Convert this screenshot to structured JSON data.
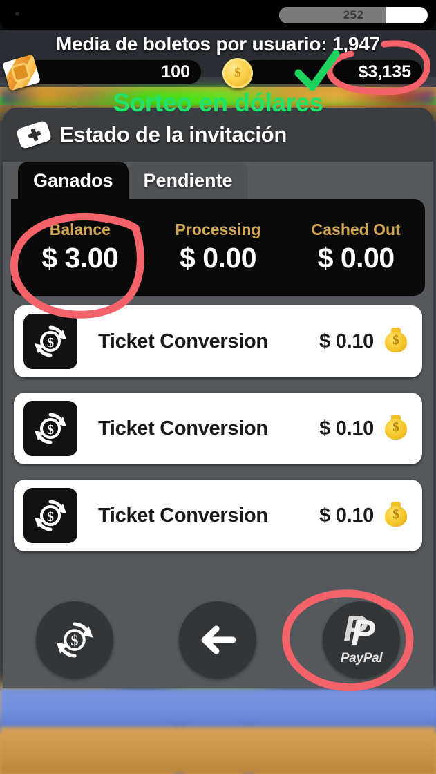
{
  "statusbar": {
    "progress_value": "252",
    "progress_percent": 72
  },
  "headline": "Media de boletos por usuario: 1,947",
  "currency": {
    "tickets": {
      "icon": "ticket-roll-icon",
      "value": "100"
    },
    "coins": {
      "icon": "gold-coin-icon",
      "value": "$3,135"
    }
  },
  "panel": {
    "header": {
      "icon": "ticket-plus-icon",
      "title": "Estado de la invitación"
    },
    "tabs": [
      {
        "label": "Ganados",
        "active": true
      },
      {
        "label": "Pendiente",
        "active": false
      }
    ],
    "stats": [
      {
        "label": "Balance",
        "value": "$ 3.00"
      },
      {
        "label": "Processing",
        "value": "$ 0.00"
      },
      {
        "label": "Cashed Out",
        "value": "$ 0.00"
      }
    ],
    "transactions": [
      {
        "icon": "conversion-icon",
        "title": "Ticket Conversion",
        "amount": "$ 0.10",
        "badge": "money-bag-icon"
      },
      {
        "icon": "conversion-icon",
        "title": "Ticket Conversion",
        "amount": "$ 0.10",
        "badge": "money-bag-icon"
      },
      {
        "icon": "conversion-icon",
        "title": "Ticket Conversion",
        "amount": "$ 0.10",
        "badge": "money-bag-icon"
      }
    ]
  },
  "bottom_nav": [
    {
      "name": "convert-button",
      "icon": "conversion-icon",
      "label": ""
    },
    {
      "name": "back-button",
      "icon": "arrow-left-icon",
      "label": ""
    },
    {
      "name": "paypal-button",
      "icon": "paypal-icon",
      "label": "PayPal"
    }
  ],
  "annotations": {
    "green_text": "Sorteo en dólares",
    "green_check": "check-mark",
    "red_color": "#f4626a",
    "green_color": "#22e06a",
    "circles": [
      "coins-value",
      "balance-stat",
      "paypal-button"
    ]
  },
  "colors": {
    "panel_bg": "#55585c",
    "panel_header_bg": "#3a3d41",
    "board_bg": "#0a0a0a",
    "stat_label": "#d3a653",
    "row_bg": "#ffffff"
  }
}
